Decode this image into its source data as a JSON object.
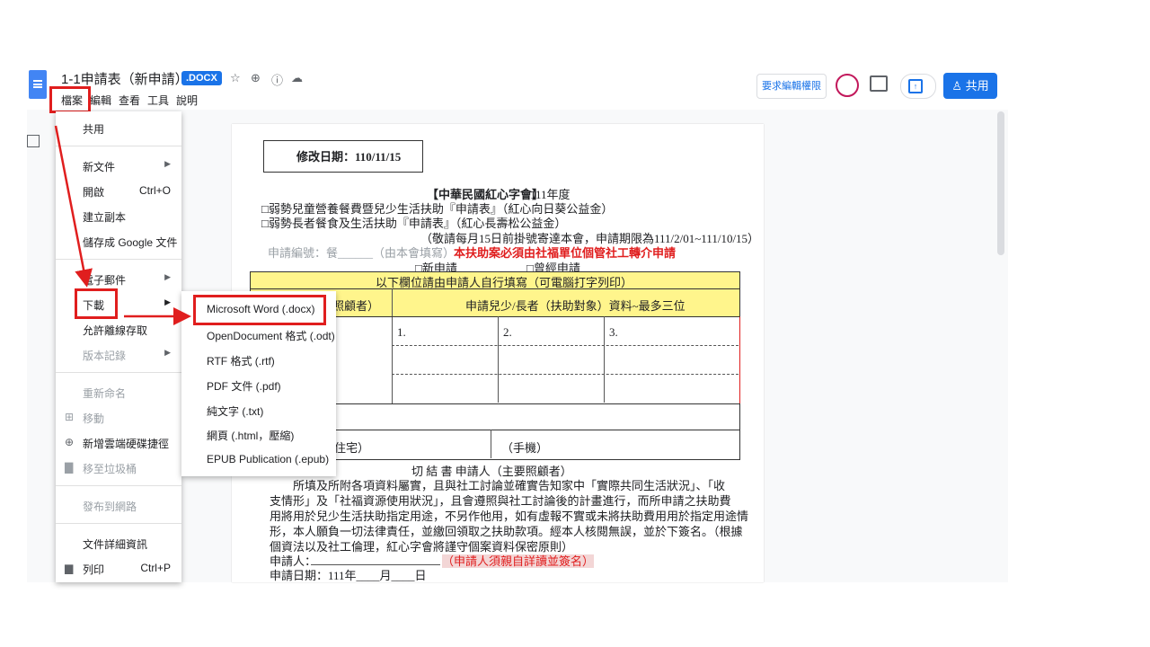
{
  "header": {
    "title": "1-1申請表（新申請）",
    "format_badge": ".DOCX",
    "request_edit": "要求編輯權限",
    "share": "共用"
  },
  "menubar": [
    "檔案",
    "編輯",
    "查看",
    "工具",
    "說明"
  ],
  "file_menu": {
    "share": "共用",
    "new": "新文件",
    "open": "開啟",
    "open_shortcut": "Ctrl+O",
    "copy": "建立副本",
    "save_google": "儲存成 Google 文件",
    "email": "電子郵件",
    "download": "下載",
    "offline": "允許離線存取",
    "version": "版本記錄",
    "rename": "重新命名",
    "move": "移動",
    "shortcut": "新增雲端硬碟捷徑",
    "trash": "移至垃圾桶",
    "publish": "發布到網路",
    "details": "文件詳細資訊",
    "print": "列印",
    "print_shortcut": "Ctrl+P"
  },
  "download_menu": [
    "Microsoft Word (.docx)",
    "OpenDocument 格式 (.odt)",
    "RTF 格式 (.rtf)",
    "PDF 文件 (.pdf)",
    "純文字 (.txt)",
    "網頁 (.html，壓縮)",
    "EPUB Publication (.epub)"
  ],
  "document": {
    "revised_date": "修改日期：110/11/15",
    "org_heading": "【中華民國紅心字會】",
    "year": "111年度",
    "line1": "□弱勢兒童營養餐費暨兒少生活扶助『申請表』（紅心向日葵公益金）",
    "line2": "□弱勢長者餐食及生活扶助『申請表』（紅心長壽松公益金）",
    "line3": "（敬請每月15日前掛號寄達本會，申請期限為111/2/01~111/10/15）",
    "app_no": "申請編號：餐______（由本會填寫）",
    "notice": "本扶助案必須由社福單位個管社工轉介申請",
    "new_app": "□新申請",
    "prev_app": "□曾經申請",
    "fill_note": "以下欄位請由申請人自行填寫（可電腦打字列印）",
    "col_left": "照顧者）",
    "col_right": "申請兒少/長者（扶助對象）資料~最多三位",
    "n1": "1.",
    "n2": "2.",
    "n3": "3.",
    "home": "住宅）",
    "mobile": "（手機）",
    "affidavit": "切 結 書  申請人（主要照顧者）",
    "para1": "所填及所附各項資料屬實，且與社工討論並確實告知家中「實際共同生活狀況」、「收",
    "para2": "支情形」及「社福資源使用狀況」，且會遵照與社工討論後的計畫進行，而所申請之扶助費",
    "para3": "用將用於兒少生活扶助指定用途，不另作他用，如有虛報不實或未將扶助費用用於指定用途情",
    "para4": "形，本人願負一切法律責任，並繳回領取之扶助款項。經本人核閱無誤，並於下簽名。（根據",
    "para5": "個資法以及社工倫理，紅心字會將謹守個案資料保密原則）",
    "applicant": "申請人：",
    "sign_note": "（申請人須親自詳讀並簽名）",
    "app_date": "申請日期：111年____月____日"
  }
}
